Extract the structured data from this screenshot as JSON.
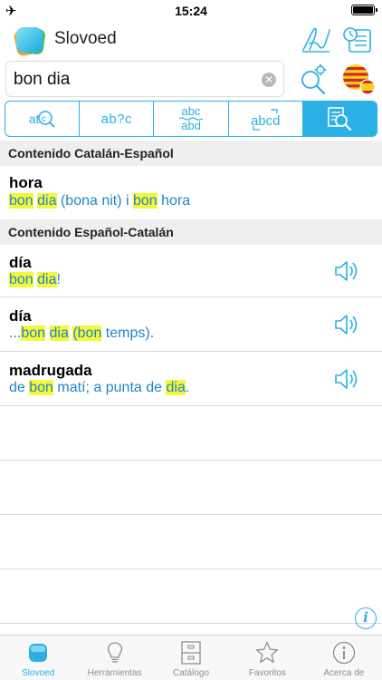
{
  "status_bar": {
    "time": "15:24",
    "airplane_icon": "airplane-icon",
    "battery_icon": "battery-icon"
  },
  "header": {
    "app_name": "Slovoed",
    "icons": [
      "handwriting-icon",
      "history-icon"
    ]
  },
  "search": {
    "value": "bon dia",
    "clear_icon": "clear-icon",
    "settings_icon": "search-settings-icon",
    "language_flag": "catalan-spanish-flag-icon"
  },
  "modes": [
    {
      "label": "at",
      "icon": "search-word-mode-icon",
      "active": false
    },
    {
      "label": "ab?c",
      "icon": "wildcard-search-mode-icon",
      "active": false
    },
    {
      "label_top": "abc",
      "label_bottom": "abd",
      "icon": "fuzzy-search-mode-icon",
      "active": false
    },
    {
      "label": "abcd",
      "icon": "anagram-mode-icon",
      "active": false
    },
    {
      "icon": "full-text-search-mode-icon",
      "active": true
    }
  ],
  "results": {
    "section1": {
      "title": "Contenido Catalán-Español",
      "entries": [
        {
          "headword": "hora",
          "t1": "bon",
          "t2": " ",
          "t3": "dia",
          "t4": " (bona nit) i ",
          "t5": "bon",
          "t6": " hora"
        }
      ]
    },
    "section2": {
      "title": "Contenido Español-Catalán",
      "entries": [
        {
          "headword": "día",
          "t1": "bon",
          "t2": " ",
          "t3": "dia",
          "t4": "!"
        },
        {
          "headword": "día",
          "t0": "...",
          "t1": "bon",
          "t2": " ",
          "t3": "dia",
          "t4": " ",
          "t5": "(bon",
          "t6": " temps)."
        },
        {
          "headword": "madrugada",
          "t0": "de ",
          "t1": "bon",
          "t2": " matí; a punta de ",
          "t3": "dia",
          "t4": "."
        }
      ]
    }
  },
  "tabbar": [
    {
      "label": "Slovoed",
      "icon": "slovoed-tab-icon",
      "active": true
    },
    {
      "label": "Herramientas",
      "icon": "lightbulb-icon",
      "active": false
    },
    {
      "label": "Catálogo",
      "icon": "cabinet-icon",
      "active": false
    },
    {
      "label": "Favoritos",
      "icon": "star-icon",
      "active": false
    },
    {
      "label": "Acerca de",
      "icon": "info-icon",
      "active": false
    }
  ],
  "colors": {
    "accent": "#2bb0e6",
    "highlight": "#f4f73a",
    "translation_text": "#1f86c8",
    "section_bg": "#efeff0"
  }
}
